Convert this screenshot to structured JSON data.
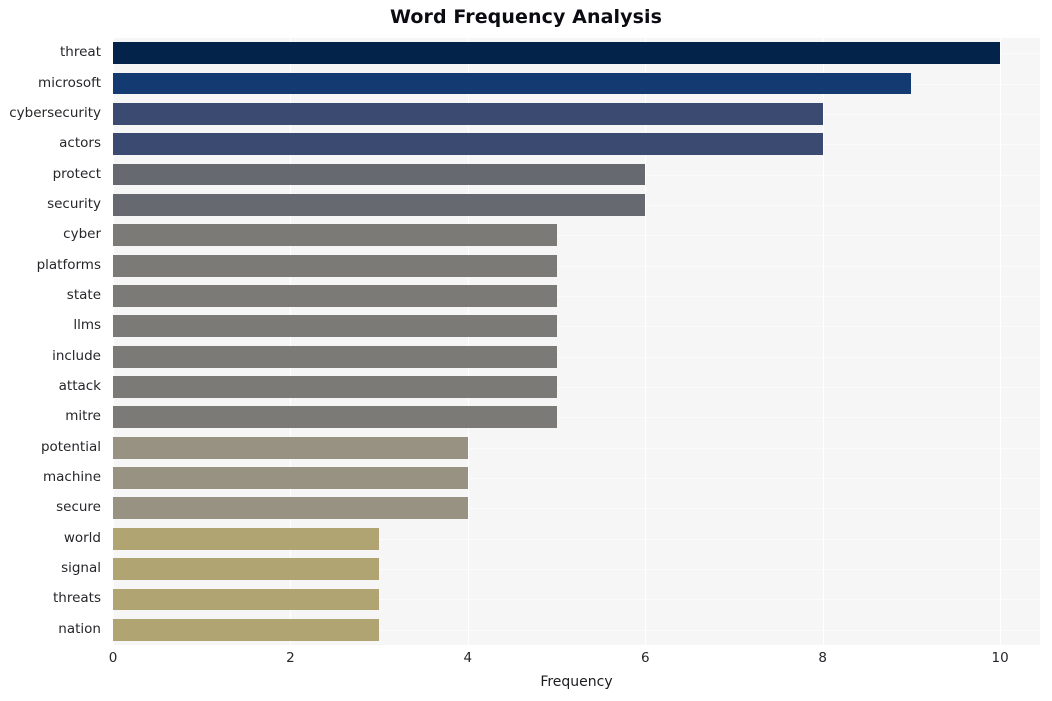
{
  "chart_data": {
    "type": "bar",
    "orientation": "horizontal",
    "title": "Word Frequency Analysis",
    "xlabel": "Frequency",
    "ylabel": "",
    "xlim": [
      0,
      10.45
    ],
    "xticks": [
      0,
      2,
      4,
      6,
      8,
      10
    ],
    "xtick_labels": [
      "0",
      "2",
      "4",
      "6",
      "8",
      "10"
    ],
    "grid": true,
    "legend": null,
    "categories": [
      "threat",
      "microsoft",
      "cybersecurity",
      "actors",
      "protect",
      "security",
      "cyber",
      "platforms",
      "state",
      "llms",
      "include",
      "attack",
      "mitre",
      "potential",
      "machine",
      "secure",
      "world",
      "signal",
      "threats",
      "nation"
    ],
    "values": [
      10,
      9,
      8,
      8,
      6,
      6,
      5,
      5,
      5,
      5,
      5,
      5,
      5,
      4,
      4,
      4,
      3,
      3,
      3,
      3
    ],
    "bar_colors": [
      "#04234b",
      "#133b72",
      "#3b4a71",
      "#3b4a71",
      "#676971",
      "#676971",
      "#7b7a77",
      "#7b7a77",
      "#7b7a77",
      "#7b7a77",
      "#7b7a77",
      "#7b7a77",
      "#7b7a77",
      "#979281",
      "#979281",
      "#979281",
      "#b0a472",
      "#b0a472",
      "#b0a472",
      "#b0a472"
    ]
  },
  "style": {
    "figure_background": "#ffffff",
    "plot_background": "#f6f6f7",
    "gridline_color": "#ffffff",
    "title_color": "#0b0b12",
    "tick_color": "#26262b"
  }
}
